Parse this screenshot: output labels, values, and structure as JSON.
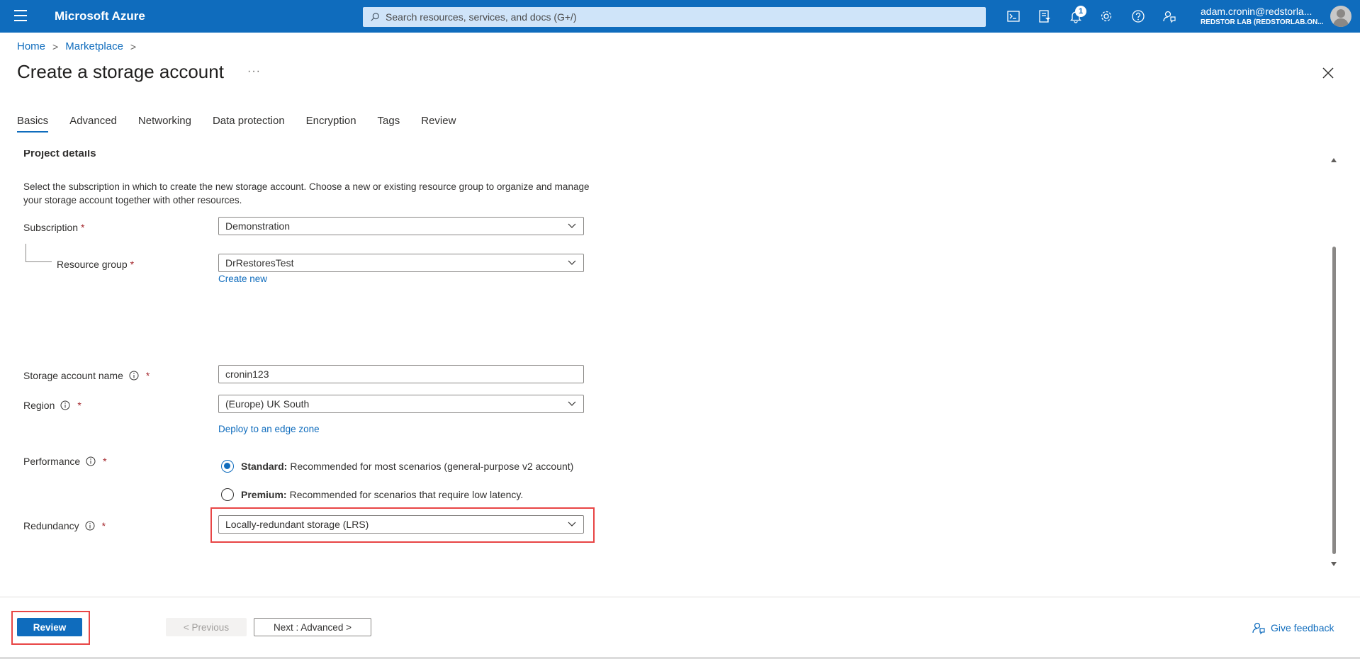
{
  "topbar": {
    "brand": "Microsoft Azure",
    "search_placeholder": "Search resources, services, and docs (G+/)",
    "notification_count": "1",
    "user_email": "adam.cronin@redstorla...",
    "user_tenant": "REDSTOR LAB (REDSTORLAB.ON...",
    "icons": [
      "cloud-shell-icon",
      "directory-filter-icon",
      "bell-icon",
      "gear-icon",
      "help-icon",
      "feedback-icon"
    ]
  },
  "breadcrumb": {
    "home": "Home",
    "marketplace": "Marketplace"
  },
  "page": {
    "title": "Create a storage account",
    "more": "···"
  },
  "tabs": [
    "Basics",
    "Advanced",
    "Networking",
    "Data protection",
    "Encryption",
    "Tags",
    "Review"
  ],
  "active_tab": "Basics",
  "project": {
    "heading": "Project details",
    "description": "Select the subscription in which to create the new storage account. Choose a new or existing resource group to organize and manage your storage account together with other resources."
  },
  "form": {
    "subscription_label": "Subscription",
    "subscription_value": "Demonstration",
    "resource_group_label": "Resource group",
    "resource_group_value": "DrRestoresTest",
    "create_new": "Create new",
    "storage_name_label": "Storage account name",
    "storage_name_value": "cronin123",
    "region_label": "Region",
    "region_value": "(Europe) UK South",
    "edge_zone_link": "Deploy to an edge zone",
    "performance_label": "Performance",
    "standard_label": "Standard:",
    "standard_desc": "Recommended for most scenarios (general-purpose v2 account)",
    "premium_label": "Premium:",
    "premium_desc": "Recommended for scenarios that require low latency.",
    "performance_selected": "Standard",
    "redundancy_label": "Redundancy",
    "redundancy_value": "Locally-redundant storage (LRS)",
    "required_mark": "*"
  },
  "footer": {
    "review": "Review",
    "previous": "< Previous",
    "next": "Next : Advanced >",
    "feedback": "Give feedback"
  },
  "colors": {
    "accent": "#0f6cbd",
    "highlight": "#e84545"
  }
}
